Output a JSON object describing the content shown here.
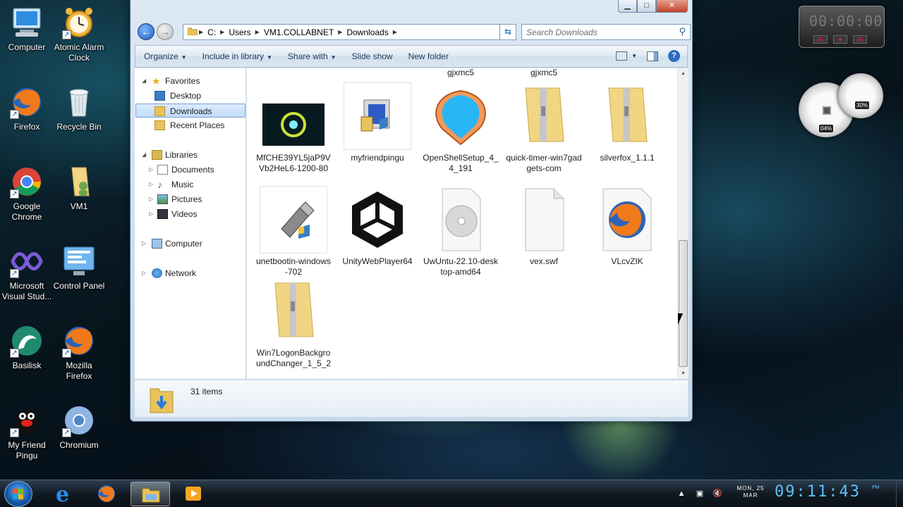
{
  "desktop": {
    "icons": [
      {
        "label": "Computer"
      },
      {
        "label": "Atomic Alarm Clock"
      },
      {
        "label": "Firefox"
      },
      {
        "label": "Recycle Bin"
      },
      {
        "label": "Google Chrome"
      },
      {
        "label": "VM1"
      },
      {
        "label": "Microsoft Visual Stud..."
      },
      {
        "label": "Control Panel"
      },
      {
        "label": "Basilisk"
      },
      {
        "label": "Mozilla Firefox"
      },
      {
        "label": "My Friend Pingu"
      },
      {
        "label": "Chromium"
      }
    ]
  },
  "window": {
    "address": {
      "crumbs": [
        "C:",
        "Users",
        "VM1.COLLABNET",
        "Downloads"
      ]
    },
    "search": {
      "placeholder": "Search Downloads"
    },
    "toolbar": {
      "organize": "Organize",
      "include": "Include in library",
      "share": "Share with",
      "slideshow": "Slide show",
      "newfolder": "New folder"
    },
    "nav": {
      "favorites": "Favorites",
      "desktop": "Desktop",
      "downloads": "Downloads",
      "recent": "Recent Places",
      "libraries": "Libraries",
      "documents": "Documents",
      "music": "Music",
      "pictures": "Pictures",
      "videos": "Videos",
      "computer": "Computer",
      "network": "Network"
    },
    "files": {
      "cut1": "gjxmc5",
      "cut2": "gjxmc5",
      "items": [
        {
          "name": "MfCHE39YL5jaP9VVb2HeL6-1200-80"
        },
        {
          "name": "myfriendpingu"
        },
        {
          "name": "OpenShellSetup_4_4_191"
        },
        {
          "name": "quick-timer-win7gadgets-com"
        },
        {
          "name": "silverfox_1.1.1"
        },
        {
          "name": "unetbootin-windows-702"
        },
        {
          "name": "UnityWebPlayer64"
        },
        {
          "name": "UwUntu-22.10-desktop-amd64"
        },
        {
          "name": "vex.swf"
        },
        {
          "name": "VLcvZIK"
        },
        {
          "name": "Win7LogonBackgroundChanger_1_5_2"
        }
      ]
    },
    "status": {
      "count": "31 items"
    }
  },
  "gadgets": {
    "timer": "00:00:00",
    "timer_buttons": [
      "00",
      "00"
    ],
    "cpu": "04%",
    "mem": "30%"
  },
  "taskbar": {
    "clock": {
      "day": "MON, 25",
      "month": "MAR",
      "time": "09:11:43",
      "ampm": "PM"
    }
  }
}
